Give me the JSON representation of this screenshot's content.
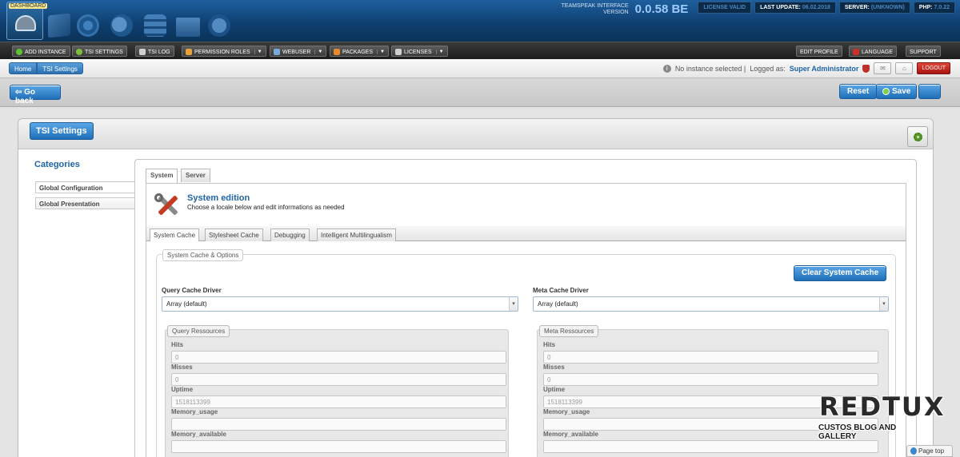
{
  "header": {
    "dashboard_label": "DASHBOARD",
    "product_line1": "TEAMSPEAK INTERFACE",
    "product_line2": "VERSION",
    "version": "0.0.58 BE",
    "license": "LICENSE VALID",
    "last_update_label": "LAST UPDATE:",
    "last_update_value": "06.02.2018",
    "server_label": "SERVER:",
    "server_value": "(UNKNOWN)",
    "php_label": "PHP:",
    "php_value": "7.0.22",
    "icons": [
      "dashboard-icon",
      "instances-icon",
      "server-icon",
      "chat-icon",
      "database-icon",
      "folder-icon",
      "globe-icon"
    ]
  },
  "menu": {
    "add_instance": "ADD INSTANCE",
    "tsi_settings": "TSI SETTINGS",
    "tsi_log": "TSI LOG",
    "permission_roles": "PERMISSION ROLES",
    "webuser": "WEBUSER",
    "packages": "PACKAGES",
    "licenses": "LICENSES",
    "edit_profile": "EDIT PROFILE",
    "language": "LANGUAGE",
    "support": "SUPPORT",
    "colors": {
      "add": "#5ec232",
      "settings": "#7cbf3a",
      "log": "#d0d0d0",
      "perm": "#e6a23c",
      "web": "#7aa8d8",
      "pack": "#e6892a",
      "lic": "#cfcfcf"
    }
  },
  "breadcrumb": {
    "home": "Home",
    "current": "TSI Settings"
  },
  "status": {
    "instance": "No instance selected |",
    "logged_as": "Logged as:",
    "user": "Super Administrator",
    "logout": "LOGOUT"
  },
  "toolbar": {
    "go_back": "⇦ Go back",
    "reset": "Reset",
    "save": "Save"
  },
  "panel": {
    "title": "TSI Settings",
    "categories_title": "Categories",
    "categories": [
      "Global Configuration",
      "Global Presentation"
    ],
    "tabs": [
      "System",
      "Server"
    ],
    "edition_title": "System edition",
    "edition_subtitle": "Choose a locale below and edit informations as needed",
    "subtabs": [
      "System Cache",
      "Stylesheet Cache",
      "Debugging",
      "Intelligent Multilingualism"
    ],
    "fieldset_legend": "System Cache & Options",
    "clear_cache": "Clear System Cache",
    "query_driver_label": "Query Cache Driver",
    "query_driver_value": "Array (default)",
    "meta_driver_label": "Meta Cache Driver",
    "meta_driver_value": "Array (default)",
    "query_res": {
      "legend": "Query Ressources",
      "hits_label": "Hits",
      "hits": "0",
      "misses_label": "Misses",
      "misses": "0",
      "uptime_label": "Uptime",
      "uptime": "1518113399",
      "mem_usage_label": "Memory_usage",
      "mem_usage": "",
      "mem_avail_label": "Memory_available",
      "mem_avail": ""
    },
    "meta_res": {
      "legend": "Meta Ressources",
      "hits_label": "Hits",
      "hits": "0",
      "misses_label": "Misses",
      "misses": "0",
      "uptime_label": "Uptime",
      "uptime": "1518113399",
      "mem_usage_label": "Memory_usage",
      "mem_usage": "",
      "mem_avail_label": "Memory_available",
      "mem_avail": ""
    }
  },
  "watermark": {
    "brand": "REDTUX",
    "tagline": "CUSTOS BLOG AND GALLERY"
  },
  "page_top": "Page top"
}
